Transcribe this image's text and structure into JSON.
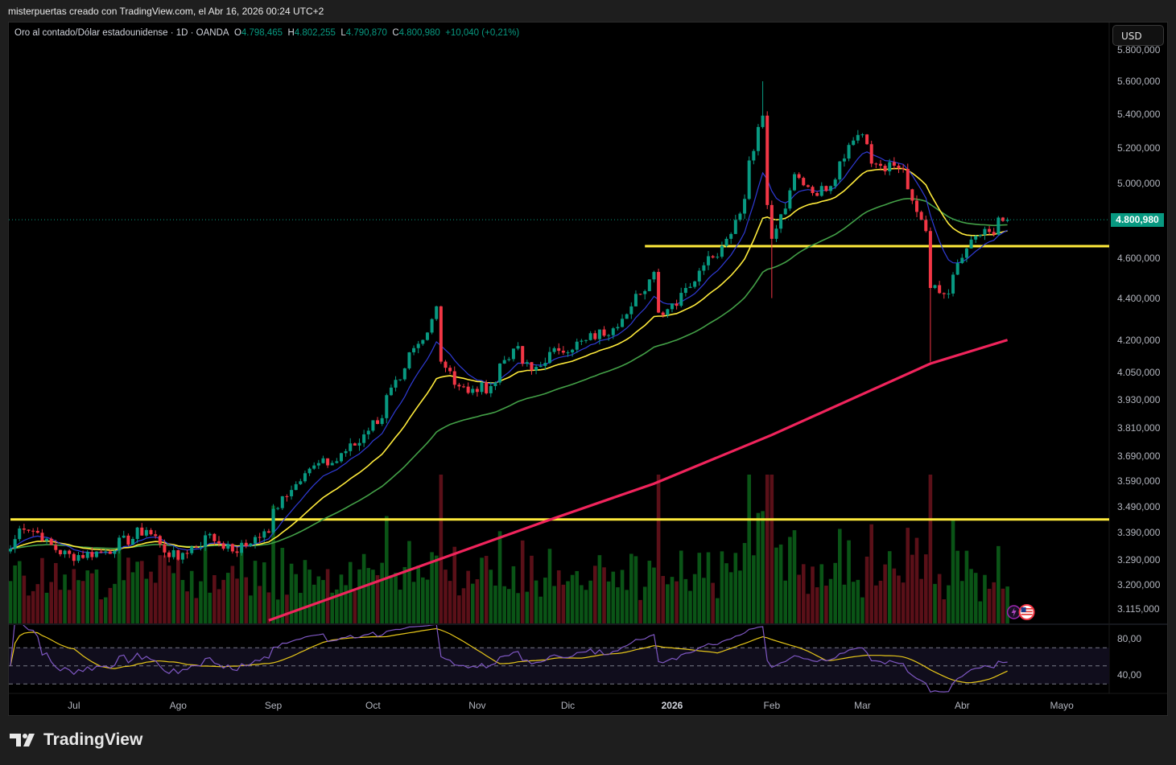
{
  "header": {
    "credit": "misterpuertas creado con TradingView.com, el Abr 16, 2026 00:24 UTC+2"
  },
  "legend": {
    "symbol": "Oro al contado/Dólar estadounidense · 1D · OANDA",
    "o_label": "O",
    "o": "4.798,465",
    "h_label": "H",
    "h": "4.802,255",
    "l_label": "L",
    "l": "4.790,870",
    "c_label": "C",
    "c": "4.800,980",
    "change": "+10,040 (+0,21%)"
  },
  "currency": "USD",
  "brand": "TradingView",
  "colors": {
    "up": "#089981",
    "down": "#f23645",
    "ema_fast": "#2f3bd6",
    "ema_mid": "#ffeb3b",
    "ema_slow": "#43a047",
    "ma200": "#f0245c",
    "hline": "#ffeb3b",
    "rsi": "#7e57c2",
    "rsi_ma": "#e6c619"
  },
  "price_axis": {
    "scale": "log",
    "ticks": [
      {
        "label": "5.800,000",
        "value": 5800
      },
      {
        "label": "5.600,000",
        "value": 5600
      },
      {
        "label": "5.400,000",
        "value": 5400
      },
      {
        "label": "5.200,000",
        "value": 5200
      },
      {
        "label": "5.000,000",
        "value": 5000
      },
      {
        "label": "4.600,000",
        "value": 4600
      },
      {
        "label": "4.400,000",
        "value": 4400
      },
      {
        "label": "4.200,000",
        "value": 4200
      },
      {
        "label": "4.050,000",
        "value": 4050
      },
      {
        "label": "3.930,000",
        "value": 3930
      },
      {
        "label": "3.810,000",
        "value": 3810
      },
      {
        "label": "3.690,000",
        "value": 3690
      },
      {
        "label": "3.590,000",
        "value": 3590
      },
      {
        "label": "3.490,000",
        "value": 3490
      },
      {
        "label": "3.390,000",
        "value": 3390
      },
      {
        "label": "3.290,000",
        "value": 3290
      },
      {
        "label": "3.200,000",
        "value": 3200
      },
      {
        "label": "3.115,000",
        "value": 3115
      }
    ],
    "last_price_label": "4.800,980",
    "last_price": 4800.98
  },
  "rsi_axis": {
    "ticks": [
      {
        "label": "80,00",
        "value": 80
      },
      {
        "label": "40,00",
        "value": 40
      }
    ],
    "bands": [
      70,
      50,
      30
    ]
  },
  "time_axis": [
    {
      "label": "Jul",
      "date": "2025-07-01"
    },
    {
      "label": "Ago",
      "date": "2025-08-01"
    },
    {
      "label": "Sep",
      "date": "2025-09-01"
    },
    {
      "label": "Oct",
      "date": "2025-10-01"
    },
    {
      "label": "Nov",
      "date": "2025-11-01"
    },
    {
      "label": "Dic",
      "date": "2025-12-01"
    },
    {
      "label": "2026",
      "date": "2026-01-01",
      "bold": true
    },
    {
      "label": "Feb",
      "date": "2026-02-01"
    },
    {
      "label": "Mar",
      "date": "2026-03-01"
    },
    {
      "label": "Abr",
      "date": "2026-04-01"
    },
    {
      "label": "Mayo",
      "date": "2026-05-01"
    }
  ],
  "chart_data": {
    "type": "candlestick",
    "interval": "1D",
    "scale": "log",
    "closes": [
      {
        "date": "2025-06-11",
        "close": 3330
      },
      {
        "date": "2025-06-14",
        "close": 3440
      },
      {
        "date": "2025-06-28",
        "close": 3300
      },
      {
        "date": "2025-07-10",
        "close": 3320
      },
      {
        "date": "2025-07-23",
        "close": 3400
      },
      {
        "date": "2025-08-01",
        "close": 3290
      },
      {
        "date": "2025-08-11",
        "close": 3380
      },
      {
        "date": "2025-08-19",
        "close": 3320
      },
      {
        "date": "2025-08-29",
        "close": 3390
      },
      {
        "date": "2025-09-03",
        "close": 3530
      },
      {
        "date": "2025-09-11",
        "close": 3640
      },
      {
        "date": "2025-09-19",
        "close": 3670
      },
      {
        "date": "2025-09-27",
        "close": 3760
      },
      {
        "date": "2025-10-04",
        "close": 3880
      },
      {
        "date": "2025-10-09",
        "close": 4020
      },
      {
        "date": "2025-10-16",
        "close": 4200
      },
      {
        "date": "2025-10-21",
        "close": 4360
      },
      {
        "date": "2025-10-22",
        "close": 4100
      },
      {
        "date": "2025-10-30",
        "close": 3960
      },
      {
        "date": "2025-11-06",
        "close": 3990
      },
      {
        "date": "2025-11-13",
        "close": 4160
      },
      {
        "date": "2025-11-19",
        "close": 4060
      },
      {
        "date": "2025-11-27",
        "close": 4150
      },
      {
        "date": "2025-12-07",
        "close": 4200
      },
      {
        "date": "2025-12-17",
        "close": 4300
      },
      {
        "date": "2025-12-23",
        "close": 4420
      },
      {
        "date": "2025-12-26",
        "close": 4530
      },
      {
        "date": "2025-12-29",
        "close": 4330
      },
      {
        "date": "2026-01-06",
        "close": 4450
      },
      {
        "date": "2026-01-13",
        "close": 4610
      },
      {
        "date": "2026-01-19",
        "close": 4700
      },
      {
        "date": "2026-01-24",
        "close": 4970
      },
      {
        "date": "2026-01-29",
        "close": 5390
      },
      {
        "date": "2026-01-30",
        "close": 4880
      },
      {
        "date": "2026-02-02",
        "close": 4700
      },
      {
        "date": "2026-02-08",
        "close": 5050
      },
      {
        "date": "2026-02-16",
        "close": 4930
      },
      {
        "date": "2026-02-22",
        "close": 5100
      },
      {
        "date": "2026-03-01",
        "close": 5360
      },
      {
        "date": "2026-03-04",
        "close": 5110
      },
      {
        "date": "2026-03-13",
        "close": 5080
      },
      {
        "date": "2026-03-19",
        "close": 4800
      },
      {
        "date": "2026-03-23",
        "close": 4450
      },
      {
        "date": "2026-03-28",
        "close": 4400
      },
      {
        "date": "2026-04-02",
        "close": 4650
      },
      {
        "date": "2026-04-07",
        "close": 4720
      },
      {
        "date": "2026-04-15",
        "close": 4800.98
      }
    ],
    "extremes": [
      {
        "date": "2026-01-29",
        "high": 5600
      },
      {
        "date": "2026-02-02",
        "low": 4400
      },
      {
        "date": "2026-03-23",
        "low": 4100
      }
    ],
    "ma200": [
      {
        "date": "2025-08-29",
        "value": 3075
      },
      {
        "date": "2025-11-24",
        "value": 3433
      },
      {
        "date": "2025-12-26",
        "value": 3580
      },
      {
        "date": "2026-01-31",
        "value": 3779
      },
      {
        "date": "2026-03-21",
        "value": 4091
      },
      {
        "date": "2026-04-15",
        "value": 4200
      }
    ],
    "horizontal_lines": [
      {
        "value": 3440,
        "from": "2025-06-11"
      },
      {
        "value": 4662,
        "from": "2025-12-24"
      }
    ],
    "moving_averages": [
      "ema_fast",
      "ema_mid",
      "ema_slow",
      "ma200"
    ],
    "indicators": [
      "volume",
      "rsi"
    ]
  }
}
